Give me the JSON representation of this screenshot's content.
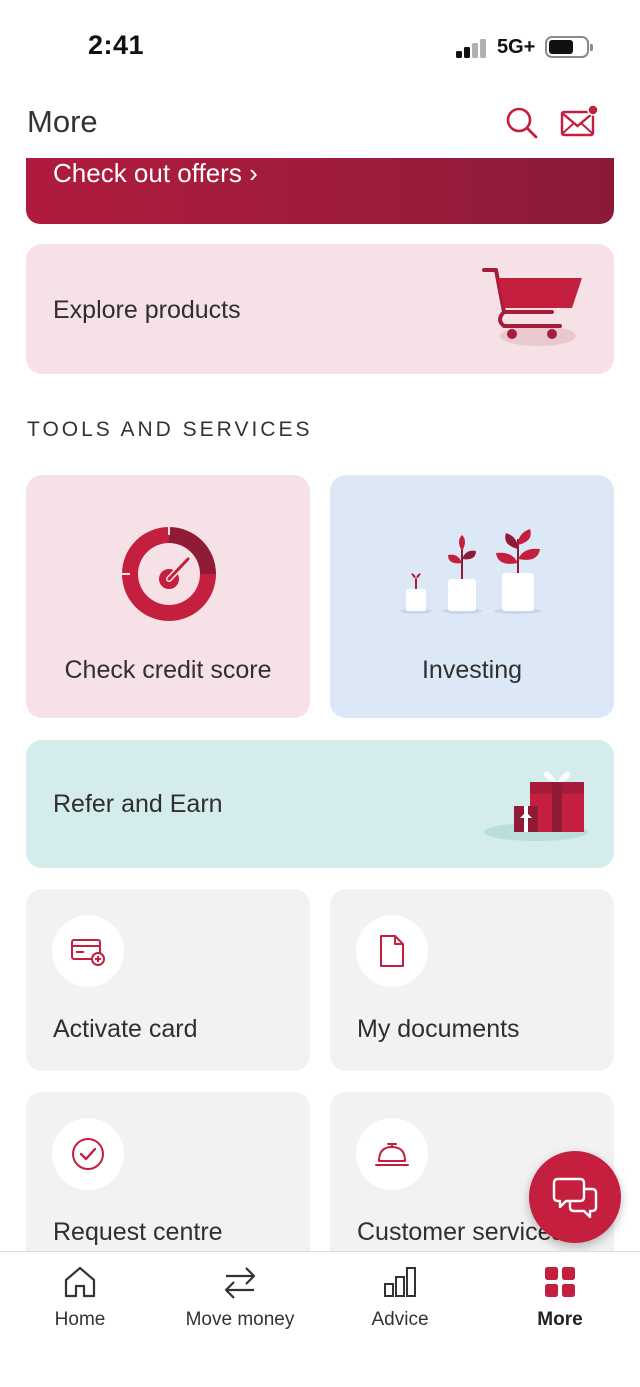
{
  "status_bar": {
    "time": "2:41",
    "network": "5G+"
  },
  "header": {
    "title": "More"
  },
  "offers_banner": {
    "link_label": "Check out offers ›"
  },
  "explore": {
    "label": "Explore products"
  },
  "tools": {
    "section_title": "TOOLS AND SERVICES",
    "credit_score_label": "Check credit score",
    "investing_label": "Investing",
    "refer_label": "Refer and Earn",
    "activate_card_label": "Activate card",
    "documents_label": "My documents",
    "request_centre_label": "Request centre",
    "customer_services_label": "Customer services"
  },
  "tab_bar": {
    "tabs": [
      {
        "label": "Home",
        "icon": "home-icon"
      },
      {
        "label": "Move money",
        "icon": "transfer-icon"
      },
      {
        "label": "Advice",
        "icon": "bar-chart-icon"
      },
      {
        "label": "More",
        "icon": "grid-icon",
        "active": true
      }
    ]
  },
  "colors": {
    "brand_red": "#c41f3e",
    "pink_card": "#f6e2e6",
    "blue_card": "#dde8f6",
    "teal_card": "#d4ecec",
    "grey_tile": "#f2f2f2"
  }
}
